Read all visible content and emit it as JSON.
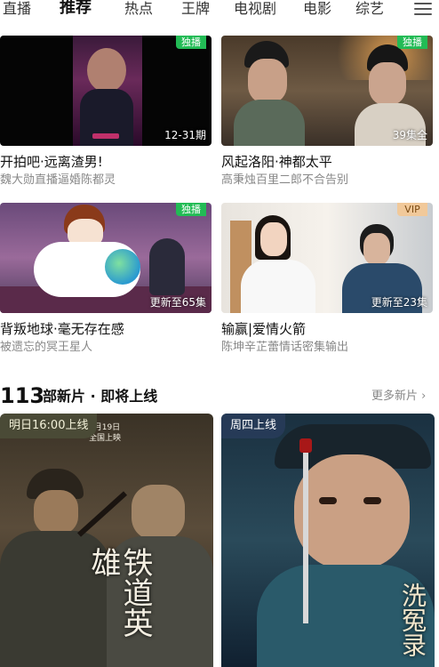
{
  "nav": {
    "tabs": [
      "直播",
      "推荐",
      "热点",
      "王牌",
      "电视剧",
      "电影",
      "综艺"
    ],
    "active_index": 1
  },
  "cards": [
    {
      "title": "开拍吧·远离渣男!",
      "subtitle": "魏大勋直播逼婚陈都灵",
      "badge": "独播",
      "overlay": "12-31期"
    },
    {
      "title": "风起洛阳·神都太平",
      "subtitle": "高秉烛百里二郎不合告别",
      "badge": "独播",
      "overlay": "39集全"
    },
    {
      "title": "背叛地球·毫无存在感",
      "subtitle": "被遗忘的冥王星人",
      "badge": "独播",
      "overlay": "更新至65集"
    },
    {
      "title": "输赢|爱情火箭",
      "subtitle": "陈坤辛芷蕾情话密集输出",
      "badge": "VIP",
      "overlay": "更新至23集"
    }
  ],
  "section": {
    "count": "113",
    "title": "部新片 · 即将上线",
    "more": "更多新片 ›"
  },
  "posters": [
    {
      "tag": "明日16:00上线",
      "caption": "铁道英雄",
      "date_text": "1月19日 全国上映"
    },
    {
      "tag": "周四上线",
      "caption": "洗冤录"
    }
  ],
  "colors": {
    "badge_green": "#22bb55",
    "vip_gold": "#f1c99a",
    "text_primary": "#111111",
    "text_secondary": "#888888"
  }
}
